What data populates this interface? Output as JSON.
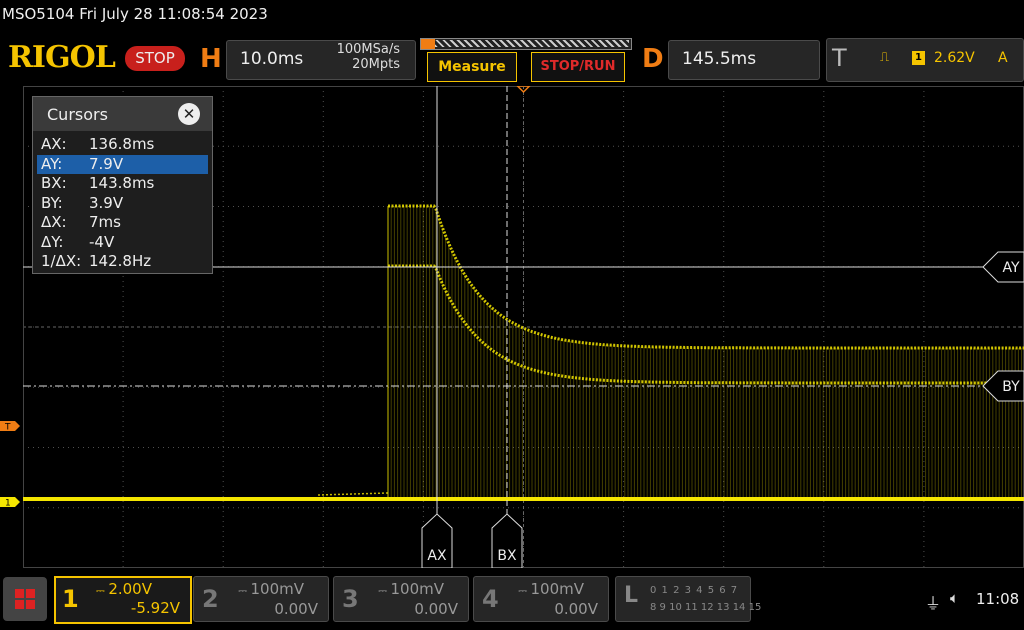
{
  "header": {
    "title_line": "MSO5104  Fri July 28 11:08:54 2023",
    "logo": "RIGOL",
    "run_state": "STOP",
    "horizontal": {
      "letter": "H",
      "timebase": "10.0ms",
      "sample_rate": "100MSa/s",
      "memory_depth": "20Mpts"
    },
    "measure_label": "Measure",
    "stop_run_label": "STOP/RUN",
    "delay": {
      "letter": "D",
      "value": "145.5ms"
    },
    "trigger": {
      "letter": "T",
      "channel": "1",
      "level": "2.62V",
      "mode": "A"
    }
  },
  "cursors": {
    "title": "Cursors",
    "close_label": "✕",
    "rows": [
      {
        "key": "AX:",
        "value": "136.8ms"
      },
      {
        "key": "AY:",
        "value": "7.9V"
      },
      {
        "key": "BX:",
        "value": "143.8ms"
      },
      {
        "key": "BY:",
        "value": "3.9V"
      },
      {
        "key": "ΔX:",
        "value": "7ms"
      },
      {
        "key": "ΔY:",
        "value": "-4V"
      },
      {
        "key": "1/ΔX:",
        "value": "142.8Hz"
      }
    ],
    "selected_row": 1,
    "labels": {
      "ax": "AX",
      "bx": "BX",
      "ay": "AY",
      "by": "BY"
    }
  },
  "waveform": {
    "markers": {
      "trigger": "T",
      "channel": "1"
    },
    "colors": {
      "trace": "#f5e600",
      "grid": "#505050",
      "accent": "#f07d14"
    }
  },
  "channels": [
    {
      "num": "1",
      "scale": "2.00V",
      "offset": "-5.92V",
      "active": true
    },
    {
      "num": "2",
      "scale": "100mV",
      "offset": "0.00V",
      "active": false
    },
    {
      "num": "3",
      "scale": "100mV",
      "offset": "0.00V",
      "active": false
    },
    {
      "num": "4",
      "scale": "100mV",
      "offset": "0.00V",
      "active": false
    }
  ],
  "logic": {
    "letter": "L",
    "row1": "0 1 2 3  4 5 6 7",
    "row2": "8 9 10 11 12 13 14 15"
  },
  "status": {
    "time": "11:08",
    "usb_icon": "usb-icon",
    "sound_icon": "speaker-muted-icon"
  }
}
